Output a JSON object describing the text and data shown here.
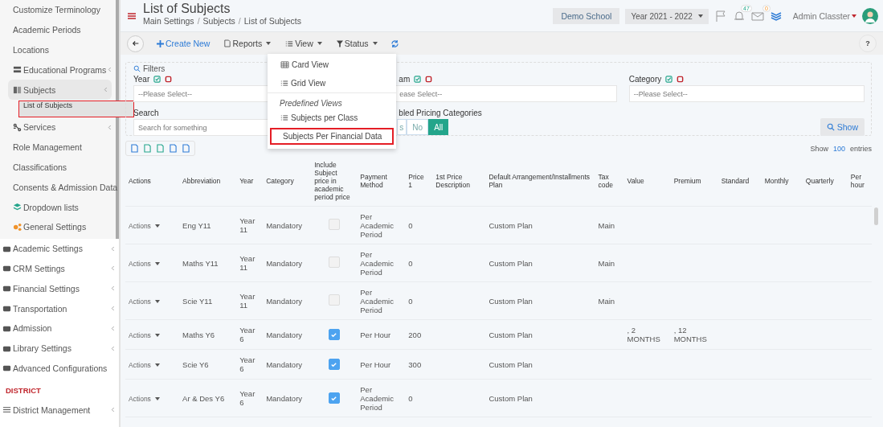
{
  "sidebar": {
    "settings_items": [
      {
        "label": "Customize Terminology",
        "expanded": false,
        "selected": false,
        "highlighted": false
      },
      {
        "label": "Academic Periods",
        "expanded": false,
        "selected": false,
        "highlighted": false
      },
      {
        "label": "Locations",
        "expanded": false,
        "selected": false,
        "highlighted": false
      },
      {
        "label": "Educational Programs",
        "expanded": false,
        "selected": false,
        "highlighted": false,
        "chevron": true
      },
      {
        "label": "Subjects",
        "expanded": true,
        "selected": false,
        "highlighted": false,
        "chevron": true,
        "children": [
          {
            "label": "List of Subjects",
            "selected": true,
            "highlighted": true
          }
        ]
      },
      {
        "label": "Services",
        "expanded": false,
        "selected": false,
        "highlighted": false,
        "chevron": true
      },
      {
        "label": "Role Management",
        "expanded": false,
        "selected": false,
        "highlighted": false
      },
      {
        "label": "Classifications",
        "expanded": false,
        "selected": false,
        "highlighted": false
      },
      {
        "label": "Consents & Admission Data",
        "expanded": false,
        "selected": false,
        "highlighted": false
      },
      {
        "label": "Dropdown lists",
        "expanded": false,
        "selected": false,
        "highlighted": false
      },
      {
        "label": "General Settings",
        "expanded": false,
        "selected": false,
        "highlighted": false
      }
    ],
    "items": [
      {
        "label": "Academic Settings",
        "chevron": true
      },
      {
        "label": "CRM Settings",
        "chevron": true
      },
      {
        "label": "Financial Settings",
        "chevron": true
      },
      {
        "label": "Transportation",
        "chevron": true
      },
      {
        "label": "Admission",
        "chevron": true
      },
      {
        "label": "Library Settings",
        "chevron": true
      },
      {
        "label": "Advanced Configurations",
        "chevron": false
      }
    ],
    "section_heading": "DISTRICT",
    "district_items": [
      {
        "label": "District Management",
        "chevron": true
      }
    ]
  },
  "header": {
    "title": "List of Subjects",
    "breadcrumb": [
      {
        "label": "Main Settings",
        "kind": "link"
      },
      {
        "label": "/",
        "kind": "separator"
      },
      {
        "label": "Subjects",
        "kind": "link"
      },
      {
        "label": "/",
        "kind": "separator"
      },
      {
        "label": "List of Subjects",
        "kind": "current"
      }
    ],
    "school": "Demo School",
    "year": "Year 2021 - 2022",
    "notifications": "47",
    "messages": "0",
    "user": "Admin Classter"
  },
  "toolbar": {
    "buttons": [
      {
        "label": "Create New",
        "kind": "create"
      },
      {
        "label": "Reports",
        "kind": "reports"
      },
      {
        "label": "View",
        "kind": "view"
      },
      {
        "label": "Status",
        "kind": "status"
      }
    ],
    "help": "?"
  },
  "view_menu": {
    "items": [
      {
        "label": "Card View",
        "kind": "card",
        "highlighted": false
      },
      {
        "label": "Grid View",
        "kind": "list",
        "highlighted": false
      }
    ],
    "section": "Predefined Views",
    "predefined": [
      {
        "label": "Subjects per Class",
        "highlighted": false
      },
      {
        "label": "Subjects Per Financial Data",
        "highlighted": true
      }
    ]
  },
  "filters": {
    "title": "Filters",
    "fields": [
      {
        "label": "Year",
        "placeholder": "--Please Select--"
      },
      {
        "label": "am",
        "placeholder": "ease Select--"
      },
      {
        "label": "Category",
        "placeholder": "--Please Select--"
      }
    ],
    "search_label": "Search",
    "search_placeholder": "Search for something",
    "pricing_label": "bled Pricing Categories",
    "pricing_options": [
      {
        "label": "s",
        "selected": false
      },
      {
        "label": "No",
        "selected": false
      },
      {
        "label": "All",
        "selected": true
      }
    ],
    "show_button": "Show"
  },
  "entries": {
    "prefix": "Show",
    "count": "100",
    "suffix": "entries"
  },
  "table": {
    "columns": [
      "Actions",
      "Abbreviation",
      "Year",
      "Category",
      "Include Subject price in academic period price",
      "Payment Method",
      "Price 1",
      "1st Price Description",
      "Default Arrangement/Installments Plan",
      "Tax code",
      "Value",
      "Premium",
      "Standard",
      "Monthly",
      "Quarterly",
      "Per hour"
    ],
    "rows": [
      {
        "actions": "Actions",
        "abbreviation": "Eng Y11",
        "year": "Year 11",
        "category": "Mandatory",
        "included": false,
        "payment": "Per Academic Period",
        "price": "0",
        "plan": "Custom Plan",
        "tax": "Main"
      },
      {
        "actions": "Actions",
        "abbreviation": "Maths Y11",
        "year": "Year 11",
        "category": "Mandatory",
        "included": false,
        "payment": "Per Academic Period",
        "price": "0",
        "plan": "Custom Plan",
        "tax": "Main"
      },
      {
        "actions": "Actions",
        "abbreviation": "Scie Y11",
        "year": "Year 11",
        "category": "Mandatory",
        "included": false,
        "payment": "Per Academic Period",
        "price": "0",
        "plan": "Custom Plan",
        "tax": "Main"
      },
      {
        "actions": "Actions",
        "abbreviation": "Maths Y6",
        "year": "Year 6",
        "category": "Mandatory",
        "included": true,
        "payment": "Per Hour",
        "price": "200",
        "plan": "Custom Plan",
        "value": ", 2 MONTHS",
        "premium": ", 12 MONTHS"
      },
      {
        "actions": "Actions",
        "abbreviation": "Scie Y6",
        "year": "Year 6",
        "category": "Mandatory",
        "included": true,
        "payment": "Per Hour",
        "price": "300",
        "plan": "Custom Plan"
      },
      {
        "actions": "Actions",
        "abbreviation": "Ar & Des Y6",
        "year": "Year 6",
        "category": "Mandatory",
        "included": true,
        "payment": "Per Academic Period",
        "price": "0",
        "plan": "Custom Plan"
      }
    ]
  }
}
